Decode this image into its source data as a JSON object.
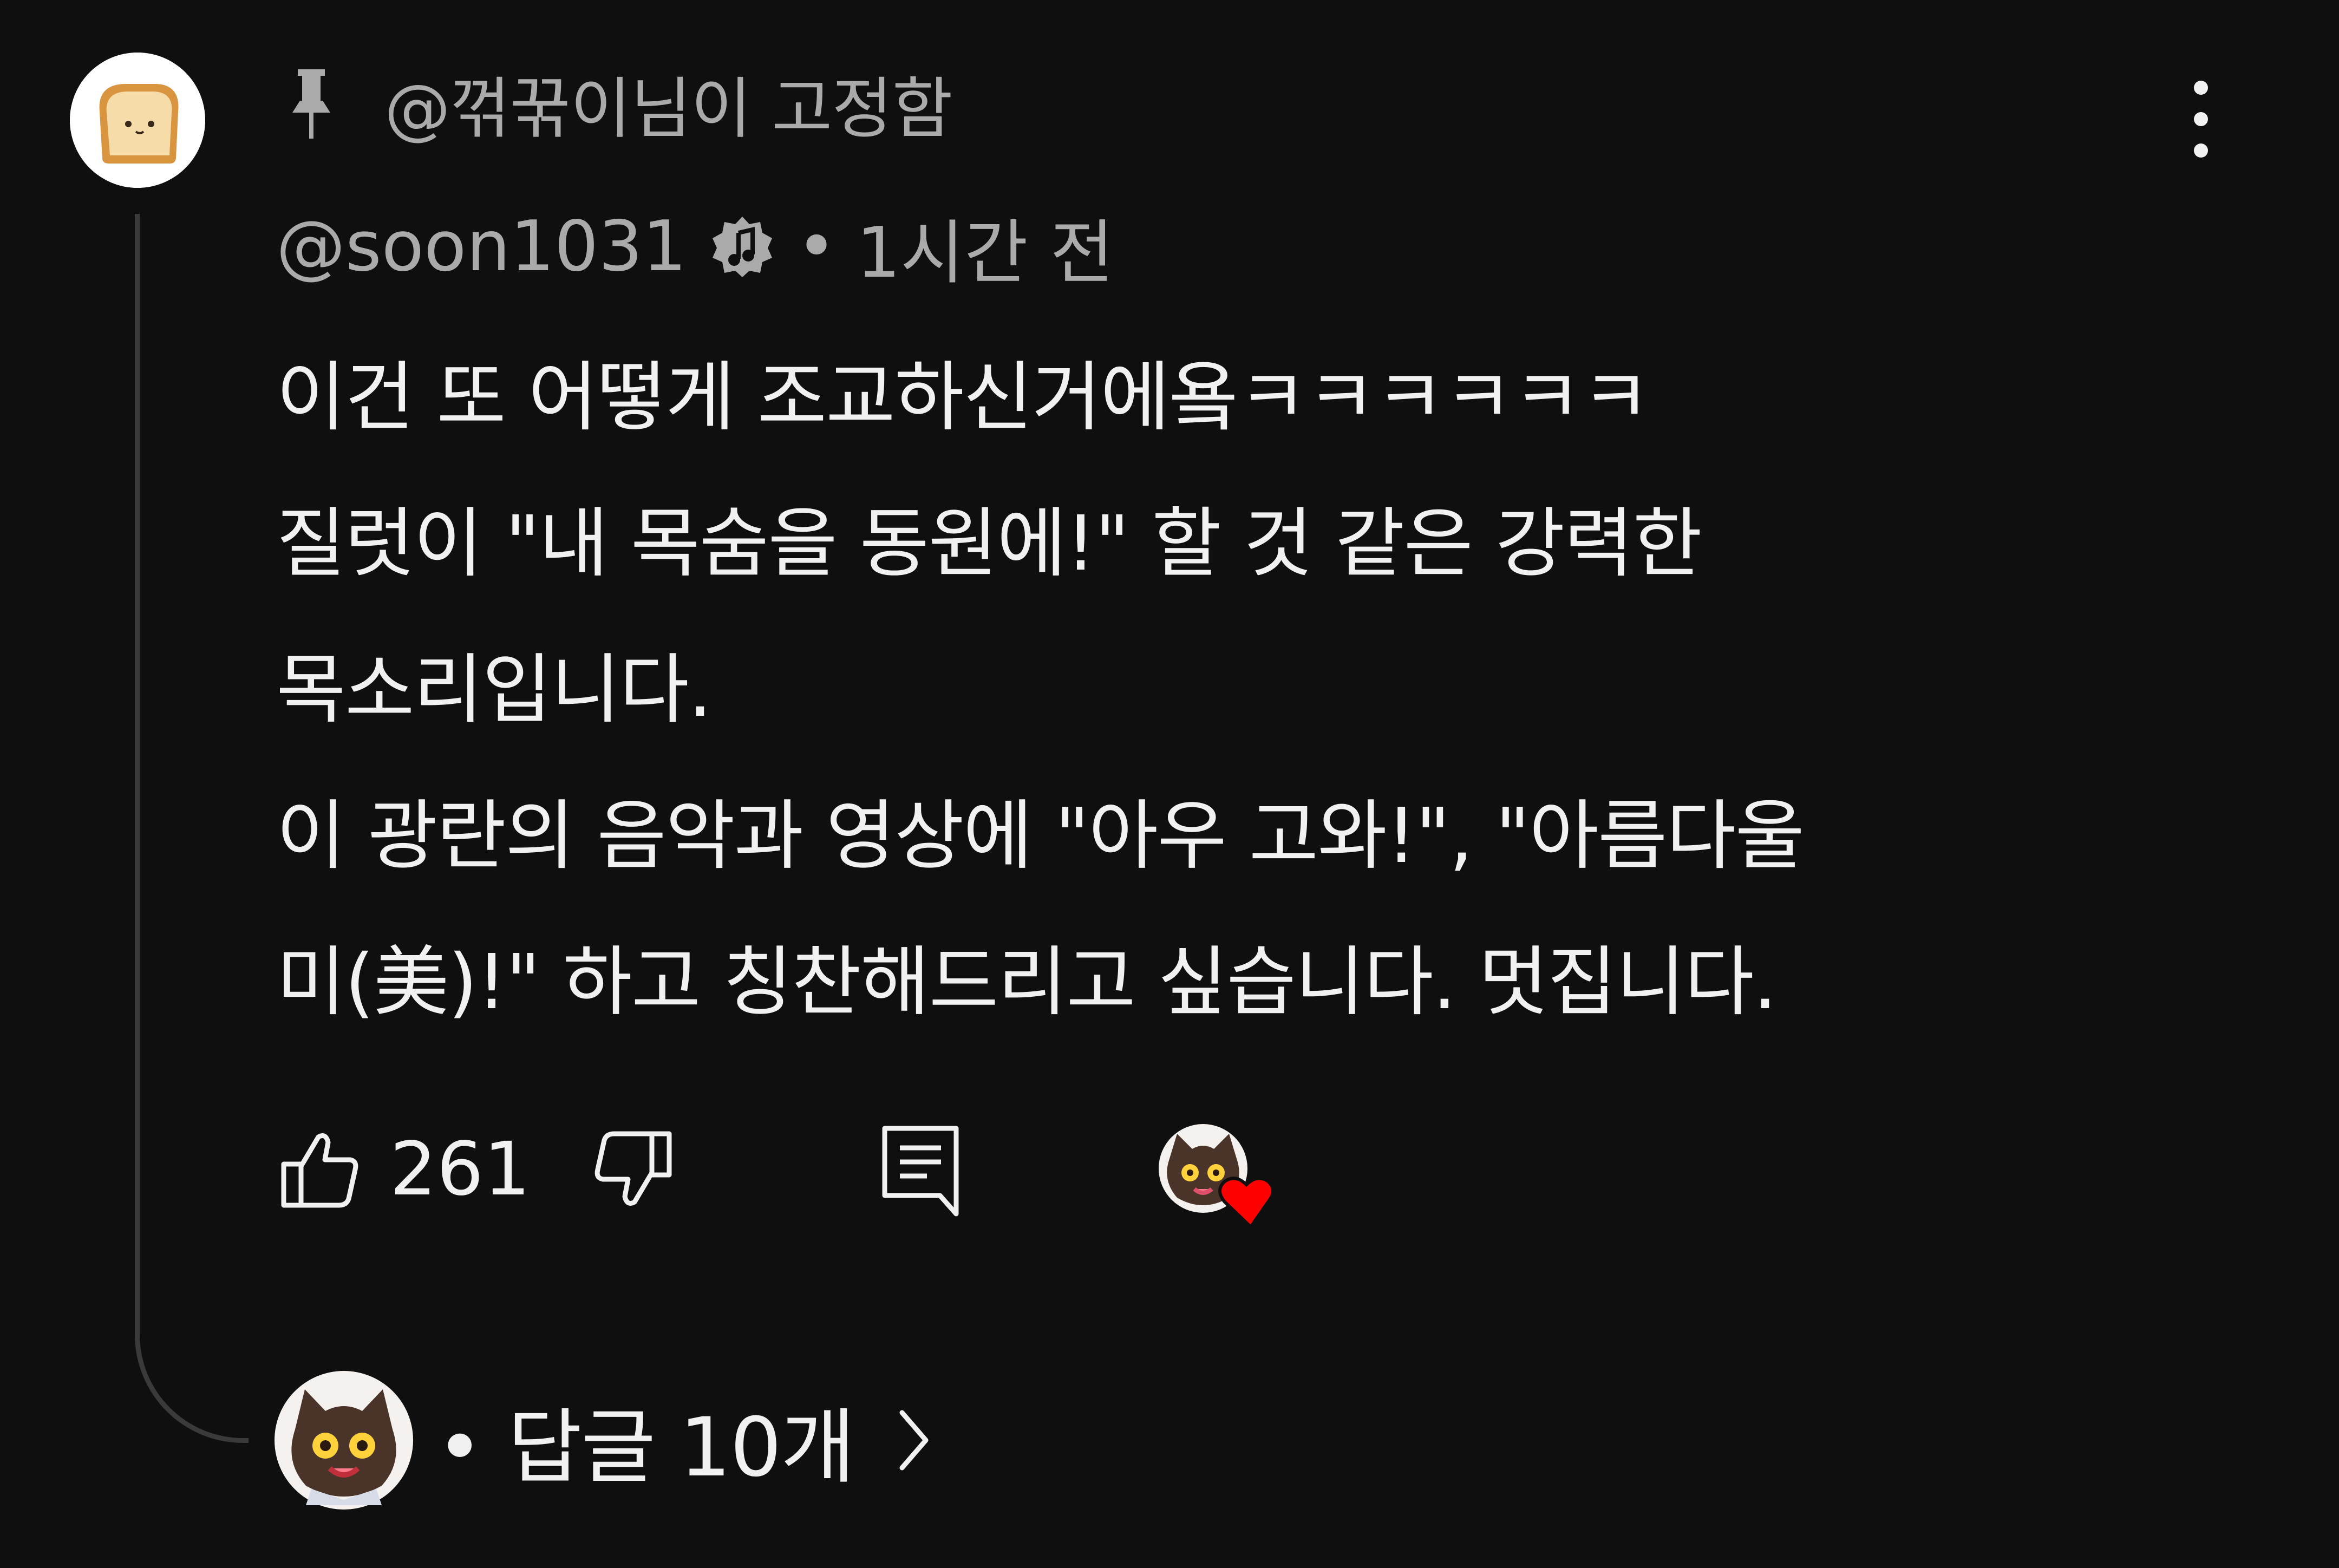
{
  "pinned": {
    "label": "@꺾꾺이님이 고정함",
    "icon": "pin-icon"
  },
  "comment": {
    "author": "@soon1031",
    "badge_icon": "music-note-badge-icon",
    "separator": "•",
    "time": "1시간 전",
    "body": "이건 또 어떻게 조교하신거에욬ㅋㅋㅋㅋㅋㅋ\n질럿이 \"내 목숨을 동원에!\" 할 것 같은 강력한\n목소리입니다.\n이 광란의 음악과 영상에 \"아우 고와!\", \"아름다울\n미(美)!\" 하고 칭찬해드리고 싶습니다. 멋집니다."
  },
  "actions": {
    "like_count": "261",
    "like_icon": "thumbs-up-icon",
    "dislike_icon": "thumbs-down-icon",
    "reply_icon": "reply-icon",
    "creator_heart_icon": "creator-heart-icon"
  },
  "replies": {
    "label": "• 답글 10개",
    "chevron_icon": "chevron-right-icon"
  },
  "colors": {
    "background": "#0f0f0f",
    "primary_text": "#f1f1f1",
    "secondary_text": "#aaaaaa",
    "heart": "#ff0000"
  }
}
